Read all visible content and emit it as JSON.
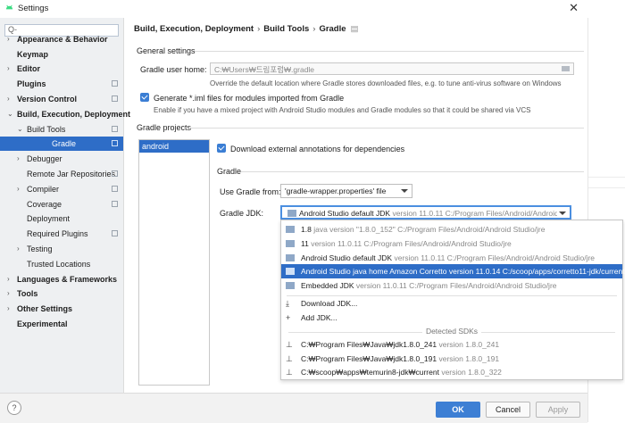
{
  "window": {
    "title": "Settings"
  },
  "search": {
    "value": "Q-"
  },
  "sidebar": {
    "items": [
      {
        "label": "Appearance & Behavior",
        "arrow": "›"
      },
      {
        "label": "Keymap",
        "arrow": ""
      },
      {
        "label": "Editor",
        "arrow": "›"
      },
      {
        "label": "Plugins",
        "arrow": ""
      },
      {
        "label": "Version Control",
        "arrow": "›"
      },
      {
        "label": "Build, Execution, Deployment",
        "arrow": "⌄"
      },
      {
        "label": "Build Tools",
        "arrow": "⌄"
      },
      {
        "label": "Gradle",
        "arrow": ""
      },
      {
        "label": "Debugger",
        "arrow": "›"
      },
      {
        "label": "Remote Jar Repositories",
        "arrow": ""
      },
      {
        "label": "Compiler",
        "arrow": "›"
      },
      {
        "label": "Coverage",
        "arrow": ""
      },
      {
        "label": "Deployment",
        "arrow": ""
      },
      {
        "label": "Required Plugins",
        "arrow": ""
      },
      {
        "label": "Testing",
        "arrow": "›"
      },
      {
        "label": "Trusted Locations",
        "arrow": ""
      },
      {
        "label": "Languages & Frameworks",
        "arrow": "›"
      },
      {
        "label": "Tools",
        "arrow": "›"
      },
      {
        "label": "Other Settings",
        "arrow": "›"
      },
      {
        "label": "Experimental",
        "arrow": ""
      }
    ]
  },
  "breadcrumb": {
    "part1": "Build, Execution, Deployment",
    "part2": "Build Tools",
    "part3": "Gradle",
    "sep": "›",
    "pin": "▤"
  },
  "general": {
    "heading": "General settings",
    "user_home_label": "Gradle user home:",
    "user_home_placeholder": "C:₩Users₩드림포럼₩.gradle",
    "user_home_hint": "Override the default location where Gradle stores downloaded files, e.g. to tune anti-virus software on Windows",
    "iml_label": "Generate *.iml files for modules imported from Gradle",
    "iml_hint": "Enable if you have a mixed project with Android Studio modules and Gradle modules so that it could be shared via VCS"
  },
  "projects": {
    "heading": "Gradle projects",
    "list": [
      "android"
    ],
    "download_annotations": "Download external annotations for dependencies",
    "gradle_heading": "Gradle",
    "use_gradle_from_label": "Use Gradle from:",
    "use_gradle_from_value": "'gradle-wrapper.properties' file",
    "gradle_jdk_label": "Gradle JDK:",
    "gradle_jdk_name": "Android Studio default JDK",
    "gradle_jdk_version": "version 11.0.11 C:/Program Files/Android/Android S"
  },
  "jdk_dropdown": {
    "items": [
      {
        "name": "1.8",
        "detail": "java version \"1.8.0_152\" C:/Program Files/Android/Android Studio/jre"
      },
      {
        "name": "11",
        "detail": "version 11.0.11 C:/Program Files/Android/Android Studio/jre"
      },
      {
        "name": "Android Studio default JDK",
        "detail": "version 11.0.11 C:/Program Files/Android/Android Studio/jre"
      },
      {
        "name": "Android Studio java home Amazon Corretto version 11.0.14 C:/scoop/apps/corretto11-jdk/current",
        "detail": ""
      },
      {
        "name": "Embedded JDK",
        "detail": "version 11.0.11 C:/Program Files/Android/Android Studio/jre"
      }
    ],
    "actions": [
      "Download JDK...",
      "Add JDK..."
    ],
    "detected_heading": "Detected SDKs",
    "detected": [
      {
        "name": "C:₩Program Files₩Java₩jdk1.8.0_241",
        "detail": "version 1.8.0_241"
      },
      {
        "name": "C:₩Program Files₩Java₩jdk1.8.0_191",
        "detail": "version 1.8.0_191"
      },
      {
        "name": "C:₩scoop₩apps₩temurin8-jdk₩current",
        "detail": "version 1.8.0_322"
      }
    ]
  },
  "footer": {
    "help": "?",
    "ok": "OK",
    "cancel": "Cancel",
    "apply": "Apply"
  },
  "colors": {
    "accent": "#2e6dc7",
    "sidebar_bg": "#eef0f2",
    "checkbox": "#3b7ed4"
  }
}
